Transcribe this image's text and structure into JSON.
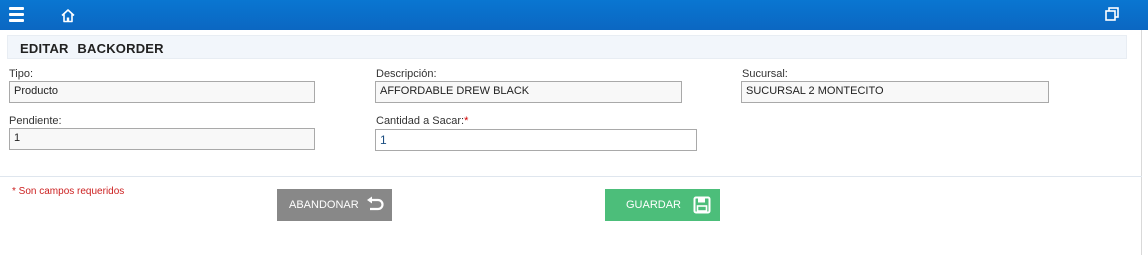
{
  "header": {
    "menu_icon": "hamburger-menu-icon",
    "home_icon": "home-icon",
    "window_icon": "restore-window-icon"
  },
  "form": {
    "title": "EDITAR  BACKORDER",
    "tipo": {
      "label": "Tipo:",
      "value": "Producto"
    },
    "descripcion": {
      "label": "Descripción:",
      "value": "AFFORDABLE DREW BLACK"
    },
    "sucursal": {
      "label": "Sucursal:",
      "value": "SUCURSAL 2 MONTECITO"
    },
    "pendiente": {
      "label": "Pendiente:",
      "value": "1"
    },
    "cantidad": {
      "label": "Cantidad a Sacar:",
      "required_mark": "*",
      "value": "1"
    }
  },
  "footer": {
    "required_note": "* Son campos requeridos",
    "abandon_label": "ABANDONAR",
    "abandon_icon": "undo-arrow-icon",
    "save_label": "GUARDAR",
    "save_icon": "save-floppy-icon",
    "colors": {
      "abandon": "#888888",
      "save": "#4cbe7a",
      "topbar": "#0a76d1",
      "required": "#cc1f1f"
    }
  }
}
